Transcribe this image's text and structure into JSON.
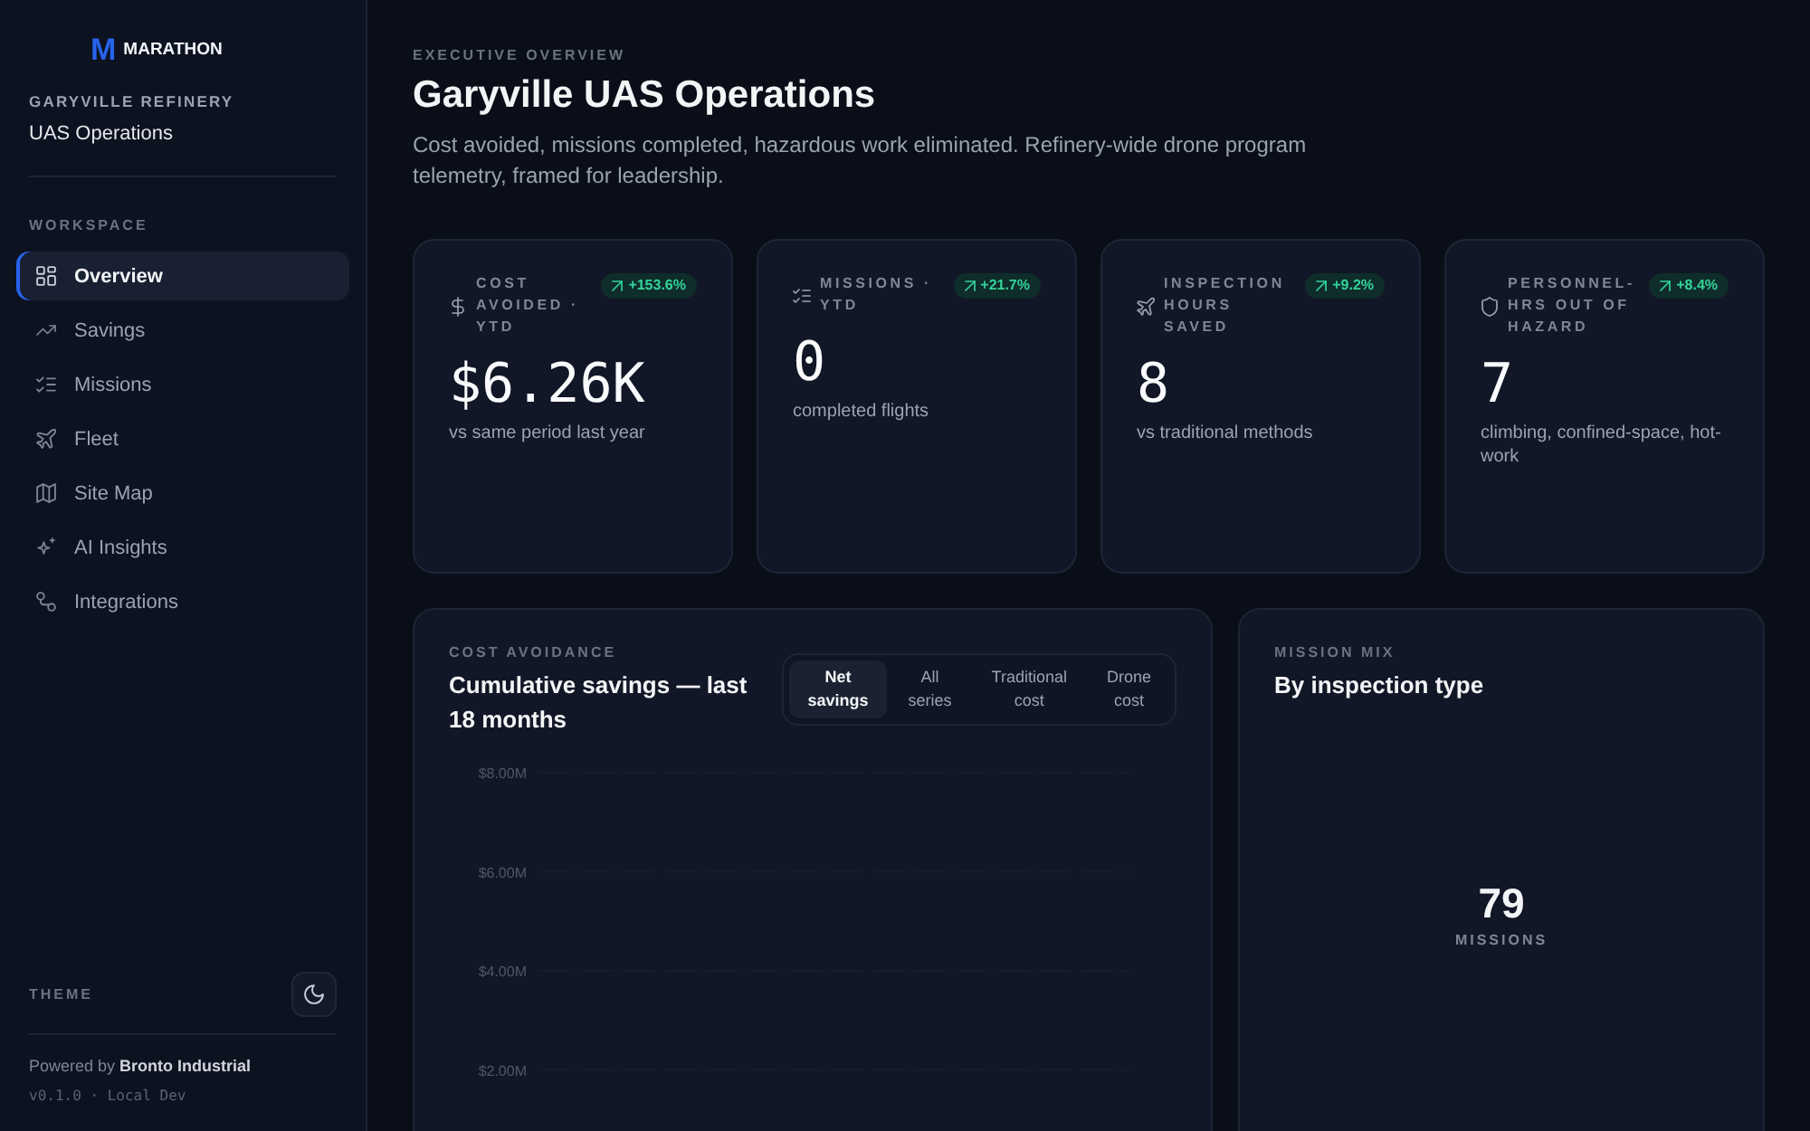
{
  "sidebar": {
    "logo": {
      "mark": "M",
      "name": "MARATHON"
    },
    "site": "GARYVILLE REFINERY",
    "app": "UAS Operations",
    "section": "WORKSPACE",
    "nav": [
      {
        "label": "Overview",
        "selected": true
      },
      {
        "label": "Savings",
        "selected": false
      },
      {
        "label": "Missions",
        "selected": false
      },
      {
        "label": "Fleet",
        "selected": false
      },
      {
        "label": "Site Map",
        "selected": false
      },
      {
        "label": "AI Insights",
        "selected": false
      },
      {
        "label": "Integrations",
        "selected": false
      }
    ],
    "theme": {
      "label": "THEME"
    },
    "footer": {
      "powered": "Powered by **Bronto Industrial**",
      "version": "v0.1.0 · Local Dev"
    }
  },
  "header": {
    "eyebrow": "EXECUTIVE OVERVIEW",
    "title": "Garyville UAS Operations",
    "description": "Cost avoided, missions completed, hazardous work eliminated. Refinery-wide drone program telemetry, framed for leadership."
  },
  "kpis": [
    {
      "label": "COST AVOIDED · YTD",
      "change": "+153.6%",
      "value": "$6.26K",
      "note": "vs same period last year"
    },
    {
      "label": "MISSIONS · YTD",
      "change": "+21.7%",
      "value": "0",
      "note": "completed flights"
    },
    {
      "label": "INSPECTION HOURS SAVED",
      "change": "+9.2%",
      "value": "8",
      "note": "vs traditional methods"
    },
    {
      "label": "PERSONNEL-HRS OUT OF HAZARD",
      "change": "+8.4%",
      "value": "7",
      "note": "climbing, confined-space, hot-work"
    }
  ],
  "cost_avoidance": {
    "eyebrow": "COST AVOIDANCE",
    "title": "Cumulative savings — last 18 months",
    "series_tabs": [
      {
        "label": "Net savings",
        "selected": true
      },
      {
        "label": "All series",
        "selected": false
      },
      {
        "label": "Traditional cost",
        "selected": false
      },
      {
        "label": "Drone cost",
        "selected": false
      }
    ],
    "y_axis_labels": [
      "$8.00M",
      "$6.00M",
      "$4.00M",
      "$2.00M"
    ]
  },
  "mission_mix": {
    "eyebrow": "MISSION MIX",
    "title": "By inspection type",
    "total": "79",
    "total_label": "MISSIONS"
  }
}
